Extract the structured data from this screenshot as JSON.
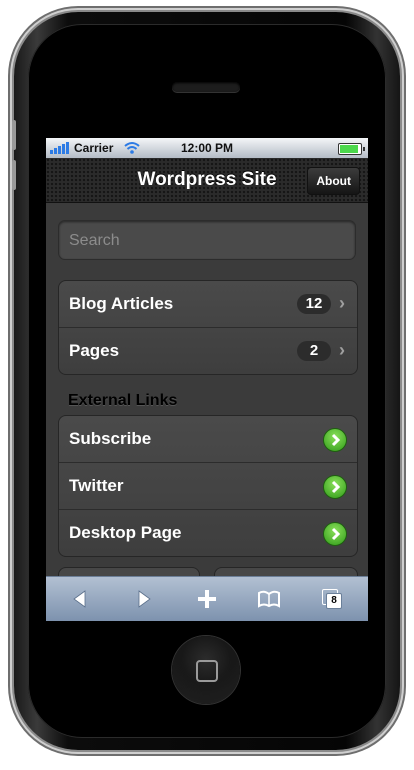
{
  "statusbar": {
    "carrier": "Carrier",
    "time": "12:00 PM"
  },
  "toolbar": {
    "title": "Wordpress Site",
    "about_label": "About"
  },
  "search": {
    "placeholder": "Search"
  },
  "main_group": [
    {
      "label": "Blog Articles",
      "count": "12"
    },
    {
      "label": "Pages",
      "count": "2"
    }
  ],
  "external": {
    "title": "External Links",
    "items": [
      {
        "label": "Subscribe"
      },
      {
        "label": "Twitter"
      },
      {
        "label": "Desktop Page"
      }
    ]
  },
  "browser_toolbar": {
    "icons": [
      "back-icon",
      "forward-icon",
      "add-icon",
      "bookmarks-icon",
      "pages-icon"
    ],
    "tab_count": "8"
  },
  "colors": {
    "accent_green": "#3fae22",
    "toolbar_blue": "#8fa3bd",
    "battery": "#4cd84c"
  }
}
